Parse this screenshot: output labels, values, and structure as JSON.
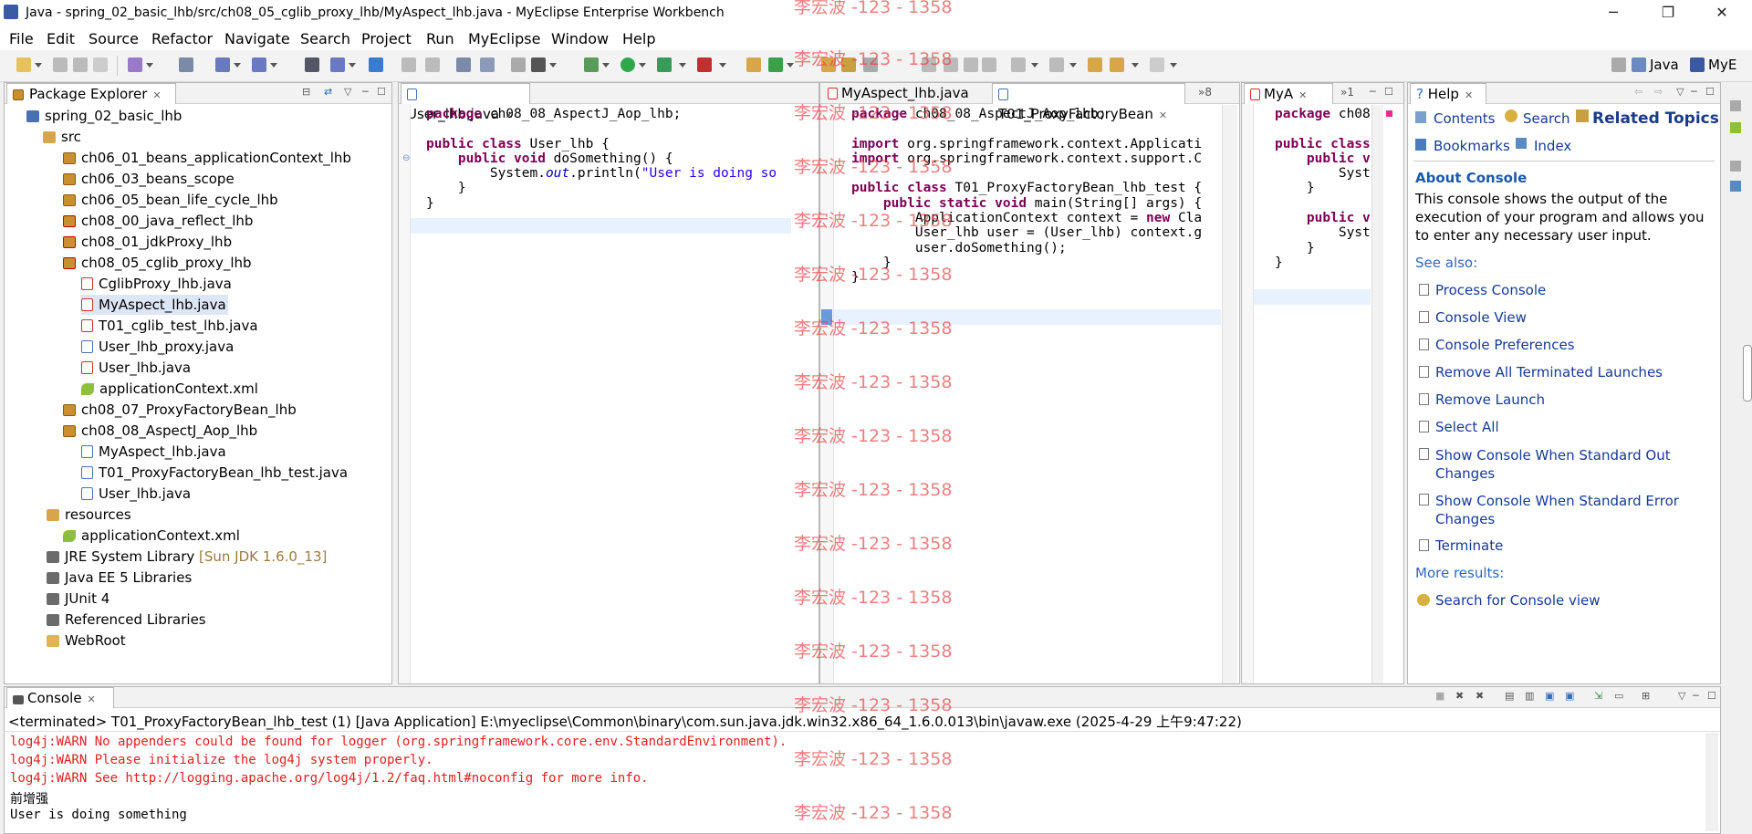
{
  "window": {
    "title": "Java - spring_02_basic_lhb/src/ch08_05_cglib_proxy_lhb/MyAspect_lhb.java - MyEclipse Enterprise Workbench",
    "minimize": "─",
    "maximize": "❐",
    "close": "✕"
  },
  "menu": [
    "File",
    "Edit",
    "Source",
    "Refactor",
    "Navigate",
    "Search",
    "Project",
    "Run",
    "MyEclipse",
    "Window",
    "Help"
  ],
  "perspectives": {
    "java": "Java",
    "myeclipse": "MyE"
  },
  "package_explorer": {
    "tab": "Package Explorer",
    "items": [
      {
        "label": "spring_02_basic_lhb"
      },
      {
        "label": "src"
      },
      {
        "label": "ch06_01_beans_applicationContext_lhb"
      },
      {
        "label": "ch06_03_beans_scope"
      },
      {
        "label": "ch06_05_bean_life_cycle_lhb"
      },
      {
        "label": "ch08_00_java_reflect_lhb"
      },
      {
        "label": "ch08_01_jdkProxy_lhb"
      },
      {
        "label": "ch08_05_cglib_proxy_lhb"
      },
      {
        "label": "CglibProxy_lhb.java"
      },
      {
        "label": "MyAspect_lhb.java"
      },
      {
        "label": "T01_cglib_test_lhb.java"
      },
      {
        "label": "User_lhb_proxy.java"
      },
      {
        "label": "User_lhb.java"
      },
      {
        "label": "applicationContext.xml"
      },
      {
        "label": "ch08_07_ProxyFactoryBean_lhb"
      },
      {
        "label": "ch08_08_AspectJ_Aop_lhb"
      },
      {
        "label": "MyAspect_lhb.java"
      },
      {
        "label": "T01_ProxyFactoryBean_lhb_test.java"
      },
      {
        "label": "User_lhb.java"
      },
      {
        "label": "resources"
      },
      {
        "label": "applicationContext.xml"
      },
      {
        "label": "JRE System Library",
        "extra": "[Sun JDK 1.6.0_13]"
      },
      {
        "label": "Java EE 5 Libraries"
      },
      {
        "label": "JUnit 4"
      },
      {
        "label": "Referenced Libraries"
      },
      {
        "label": "WebRoot"
      }
    ]
  },
  "editor1": {
    "tab": "User_lhb.java",
    "lines": {
      "l1_kw": "package",
      "l1_rest": " ch08_08_AspectJ_Aop_lhb;",
      "l3_kw": "public class",
      "l3_rest": " User_lhb {",
      "l4_kw": "    public void",
      "l4_rest": " doSomething() {",
      "l5_pre": "        System.",
      "l5_fld": "out",
      "l5_mid": ".println(",
      "l5_str": "\"User is doing so",
      "l6": "    }",
      "l7": "}"
    }
  },
  "editor2": {
    "tabs": [
      "MyAspect_lhb.java",
      "T01_ProxyFactoryBean"
    ],
    "overflow": "»8",
    "lines": {
      "l1_kw": "package",
      "l1_rest": " ch08_08_AspectJ_Aop_lhb;",
      "l3_kw": "import",
      "l3_rest": " org.springframework.context.Applicati",
      "l4_kw": "import",
      "l4_rest": " org.springframework.context.support.C",
      "l6_kw": "public class",
      "l6_rest": " T01_ProxyFactoryBean_lhb_test {",
      "l7_kw": "    public static void",
      "l7_rest": " main(String[] args) {",
      "l8_pre": "        ApplicationContext context = ",
      "l8_kw": "new",
      "l8_rest": " Cla",
      "l9": "        User_lhb user = (User_lhb) context.g",
      "l10": "        user.doSomething();",
      "l11": "    }",
      "l12": "}"
    }
  },
  "editor3": {
    "tab": "MyA",
    "overflow": "»1",
    "lines": {
      "l1_kw": "package",
      "l1_rest": " ch08",
      "l3_kw": "public class",
      "l3_rest": "",
      "l4_kw": "    public v",
      "l5": "        Syst",
      "l6": "    }",
      "l8_kw": "    public v",
      "l9": "        Syst",
      "l10": "    }",
      "l11": "}"
    }
  },
  "help": {
    "tab": "Help",
    "contents": "Contents",
    "search": "Search",
    "related": "Related Topics",
    "bookmarks": "Bookmarks",
    "index": "Index",
    "heading": "About Console",
    "description": "This console shows the output of the execution of your program and allows you to enter any necessary user input.",
    "see_also": "See also:",
    "links": [
      "Process Console",
      "Console View",
      "Console Preferences",
      "Remove All Terminated Launches",
      "Remove Launch",
      "Select All",
      "Show Console When Standard Out Changes",
      "Show Console When Standard Error Changes",
      "Terminate"
    ],
    "more_results": "More results:",
    "search_console": "Search for Console view"
  },
  "console": {
    "tab": "Console",
    "header": "<terminated> T01_ProxyFactoryBean_lhb_test (1) [Java Application] E:\\myeclipse\\Common\\binary\\com.sun.java.jdk.win32.x86_64_1.6.0.013\\bin\\javaw.exe (2025-4-29 上午9:47:22)",
    "lines": [
      "log4j:WARN No appenders could be found for logger (org.springframework.core.env.StandardEnvironment).",
      "log4j:WARN Please initialize the log4j system properly.",
      "log4j:WARN See http://logging.apache.org/log4j/1.2/faq.html#noconfig for more info.",
      "前增强",
      "User is doing something"
    ]
  },
  "watermark": "李宏波 -123 - 1358"
}
